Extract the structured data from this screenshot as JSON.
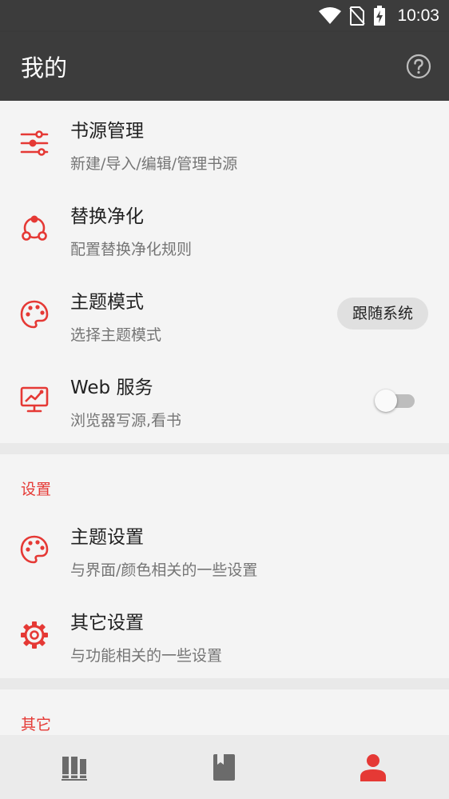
{
  "status_bar": {
    "time": "10:03",
    "icons": [
      "wifi-icon",
      "no-sim-icon",
      "battery-charging-icon"
    ]
  },
  "app_bar": {
    "title": "我的",
    "help_icon": "help-circle-icon"
  },
  "menu": [
    {
      "icon": "sliders-icon",
      "title": "书源管理",
      "subtitle": "新建/导入/编辑/管理书源"
    },
    {
      "icon": "replace-purify-icon",
      "title": "替换净化",
      "subtitle": "配置替换净化规则"
    },
    {
      "icon": "palette-icon",
      "title": "主题模式",
      "subtitle": "选择主题模式",
      "chip": "跟随系统"
    },
    {
      "icon": "web-monitor-icon",
      "title": "Web 服务",
      "subtitle": "浏览器写源,看书",
      "switch_on": false
    }
  ],
  "settings_section": {
    "header": "设置",
    "items": [
      {
        "icon": "palette-icon",
        "title": "主题设置",
        "subtitle": "与界面/颜色相关的一些设置"
      },
      {
        "icon": "gear-icon",
        "title": "其它设置",
        "subtitle": "与功能相关的一些设置"
      }
    ]
  },
  "other_section": {
    "header": "其它"
  },
  "bottom_nav": [
    {
      "icon": "bookshelf-icon",
      "active": false
    },
    {
      "icon": "book-bookmark-icon",
      "active": false
    },
    {
      "icon": "person-icon",
      "active": true
    }
  ],
  "colors": {
    "accent": "#e53935",
    "appbar": "#3c3c3c",
    "nav_inactive": "#6b6b6b"
  }
}
